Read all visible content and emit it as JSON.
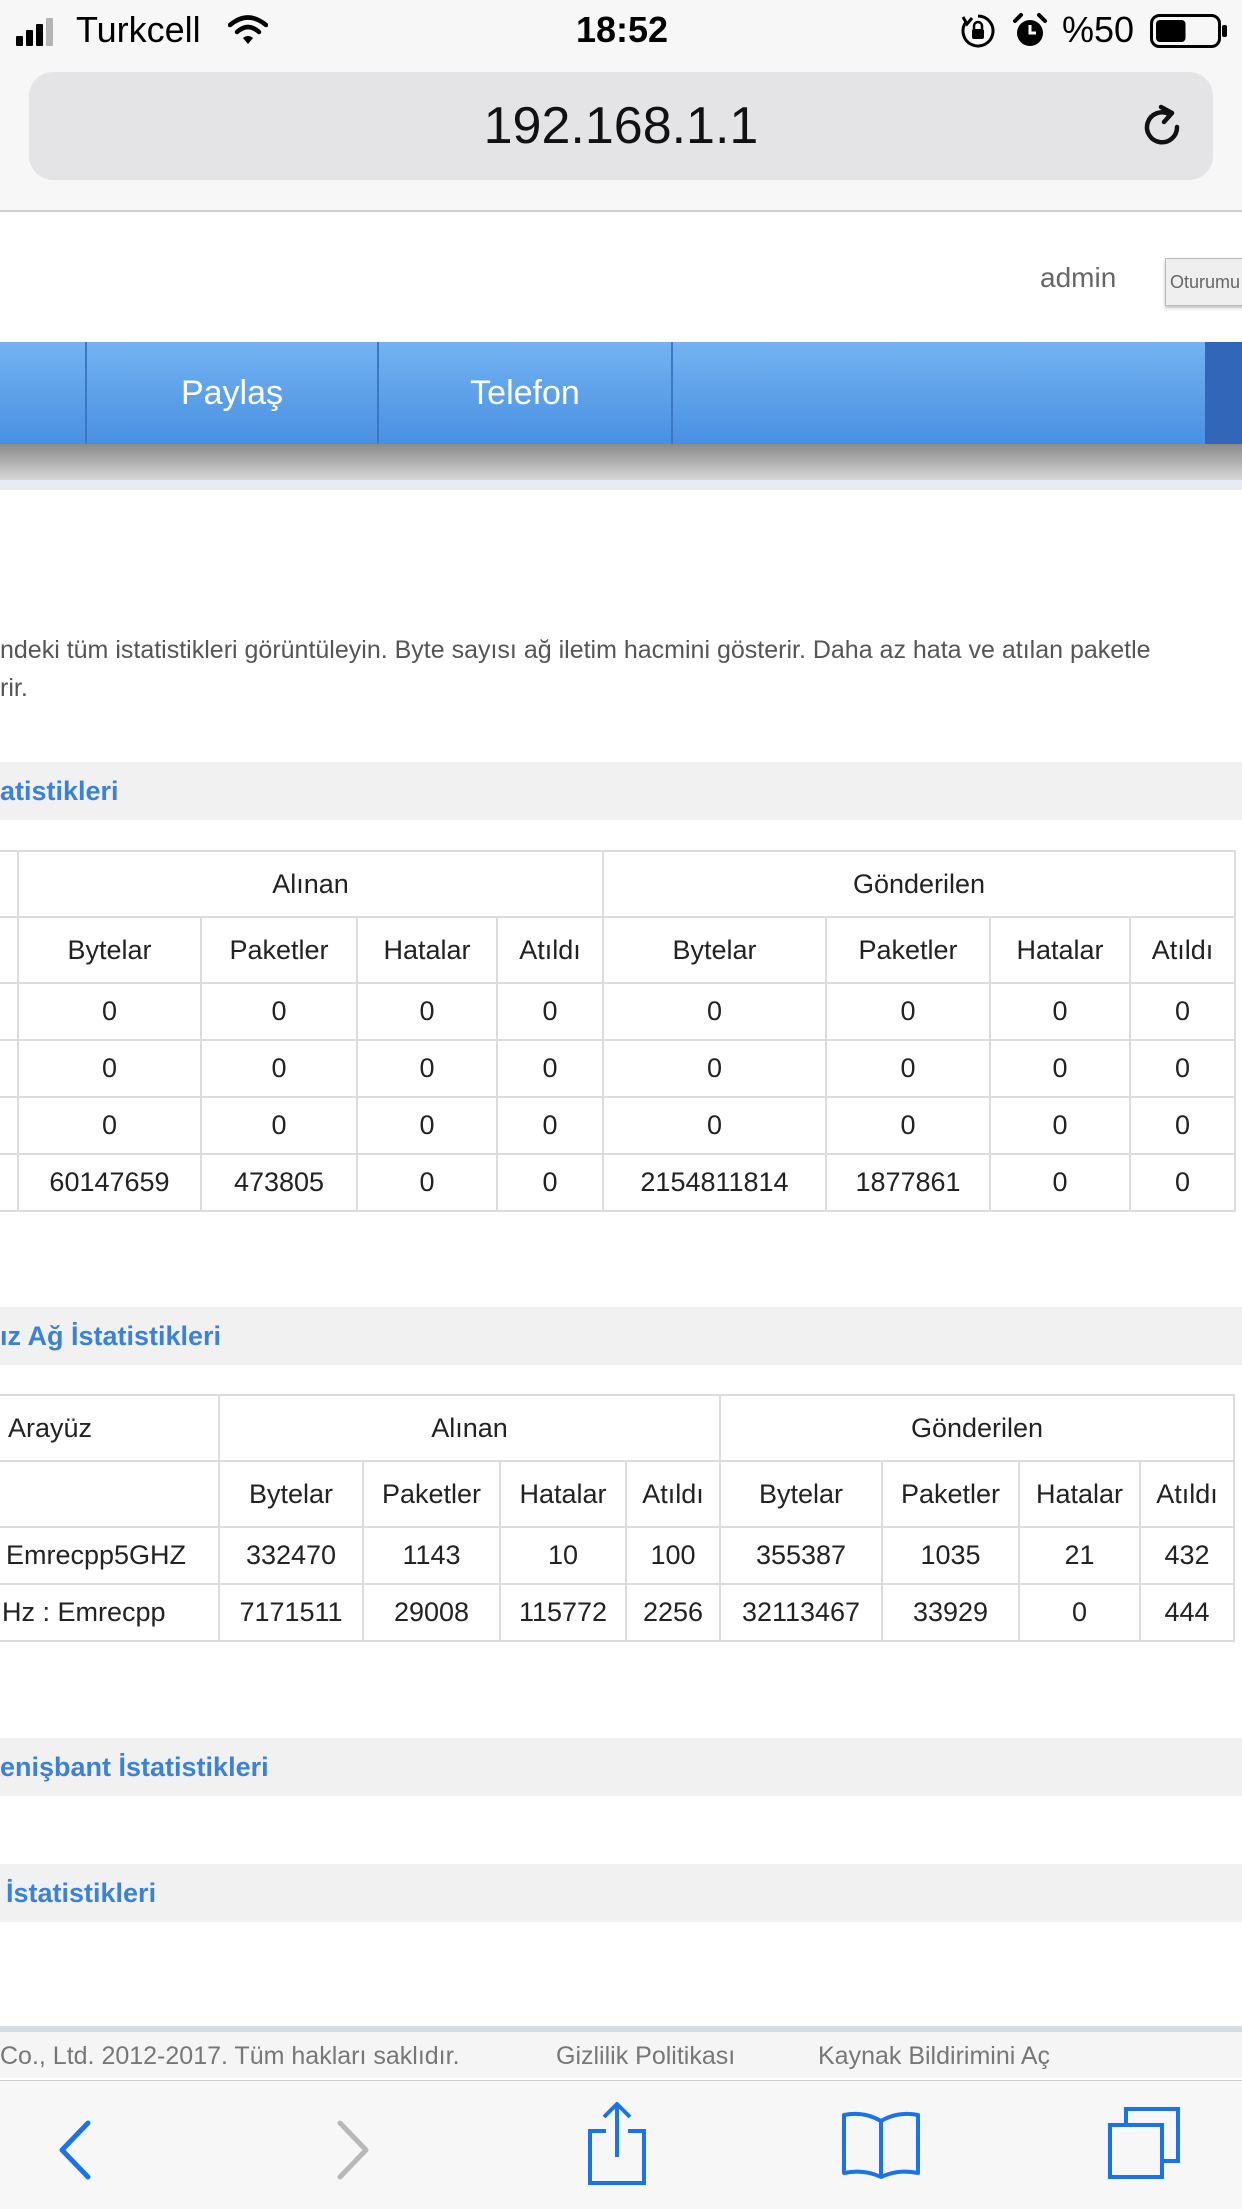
{
  "status_bar": {
    "carrier": "Turkcell",
    "time": "18:52",
    "battery": "%50",
    "battery_level": 0.5,
    "icons": [
      "signal-icon",
      "wifi-icon",
      "orientation-lock-icon",
      "alarm-icon",
      "battery-icon"
    ]
  },
  "browser": {
    "url": "192.168.1.1",
    "toolbar_icons": [
      "back-icon",
      "forward-icon",
      "share-icon",
      "bookmarks-icon",
      "tabs-icon"
    ]
  },
  "header": {
    "user": "admin",
    "logout_label": "Oturumu"
  },
  "nav": {
    "items": [
      {
        "label": "Paylaş"
      },
      {
        "label": "Telefon"
      }
    ]
  },
  "description": {
    "line1": "ndeki tüm istatistikleri görüntüleyin. Byte sayısı ağ iletim hacmini gösterir. Daha az hata ve atılan paketle",
    "line2": "rir."
  },
  "sections": {
    "lan": {
      "title": "atistikleri",
      "group_headers": [
        "Alınan",
        "Gönderilen"
      ],
      "columns": [
        "Bytelar",
        "Paketler",
        "Hatalar",
        "Atıldı",
        "Bytelar",
        "Paketler",
        "Hatalar",
        "Atıldı"
      ],
      "rows": [
        [
          "0",
          "0",
          "0",
          "0",
          "0",
          "0",
          "0",
          "0"
        ],
        [
          "0",
          "0",
          "0",
          "0",
          "0",
          "0",
          "0",
          "0"
        ],
        [
          "0",
          "0",
          "0",
          "0",
          "0",
          "0",
          "0",
          "0"
        ],
        [
          "60147659",
          "473805",
          "0",
          "0",
          "2154811814",
          "1877861",
          "0",
          "0"
        ]
      ]
    },
    "wlan": {
      "title": "ız Ağ İstatistikleri",
      "first_header": "Arayüz",
      "group_headers": [
        "Alınan",
        "Gönderilen"
      ],
      "columns": [
        "Bytelar",
        "Paketler",
        "Hatalar",
        "Atıldı",
        "Bytelar",
        "Paketler",
        "Hatalar",
        "Atıldı"
      ],
      "rows": [
        {
          "name": "Emrecpp5GHZ",
          "values": [
            "332470",
            "1143",
            "10",
            "100",
            "355387",
            "1035",
            "21",
            "432"
          ]
        },
        {
          "name": "Hz : Emrecpp",
          "values": [
            "7171511",
            "29008",
            "115772",
            "2256",
            "32113467",
            "33929",
            "0",
            "444"
          ]
        }
      ]
    },
    "broadband": {
      "title": "enişbant İstatistikleri"
    },
    "other": {
      "title": "İstatistikleri"
    }
  },
  "footer": {
    "copyright": "Co., Ltd. 2012-2017. Tüm hakları saklıdır.",
    "privacy": "Gizlilik Politikası",
    "source_notice": "Kaynak Bildirimini Aç"
  }
}
